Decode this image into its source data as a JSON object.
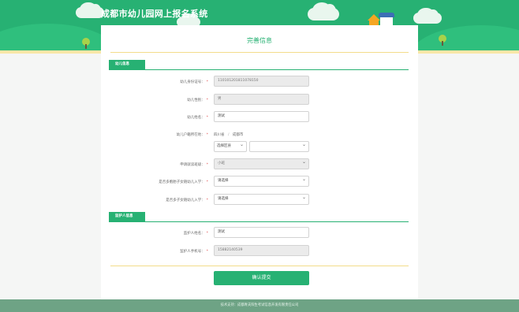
{
  "header": {
    "title": "成都市幼儿园网上报名系统"
  },
  "card": {
    "title": "完善信息"
  },
  "sections": {
    "child": "幼儿信息",
    "guardian": "监护人信息"
  },
  "child": {
    "id_label": "幼儿身份证号：",
    "id_value": "110101201811078150",
    "gender_label": "幼儿性别：",
    "gender_value": "男",
    "name_label": "幼儿姓名：",
    "name_value": "测试",
    "hukou_label": "幼儿户籍所在地：",
    "hukou_province": "四川省",
    "hukou_sep": "/",
    "hukou_city": "成都市",
    "district_select": "选择区县",
    "district_detail_select": "",
    "grade_label": "申请就读班级：",
    "grade_value": "小班",
    "multi_birth_label": "是否多胞胎子女随幼儿入学：",
    "multi_birth_value": "请选择",
    "multi_child_label": "是否多子女随幼儿入学：",
    "multi_child_value": "请选择"
  },
  "guardian": {
    "name_label": "监护人姓名：",
    "name_value": "测试",
    "phone_label": "监护人手机号：",
    "phone_value": "15882140539"
  },
  "required_mark": "*",
  "submit_label": "确认提交",
  "footer": {
    "text": "技术支持：成都青夫阳生考试信息开发有限责任公司"
  },
  "colors": {
    "primary": "#27b173",
    "required": "#e04f4f",
    "footer_bg": "#6ea385"
  }
}
